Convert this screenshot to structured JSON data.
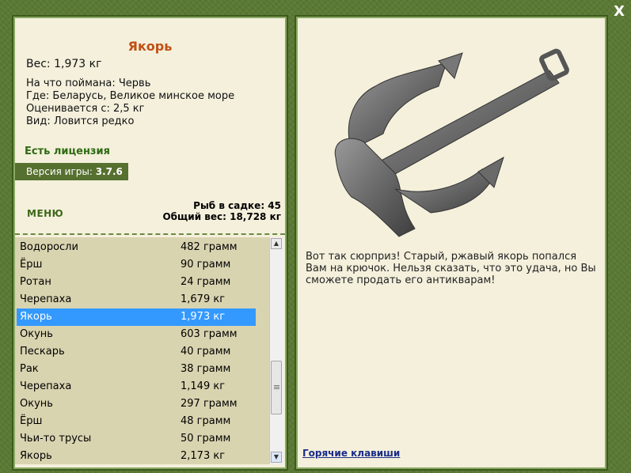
{
  "close_label": "X",
  "fish": {
    "title": "Якорь",
    "weight": "Вес: 1,973 кг",
    "caught_on": "На что поймана: Червь",
    "where": "Где: Беларусь, Великое минское море",
    "valued_from": "Оценивается с: 2,5 кг",
    "kind": "Вид: Ловится редко"
  },
  "license": "Есть лицензия",
  "version": {
    "label": "Версия игры:",
    "value": "3.7.6"
  },
  "menu_label": "МЕНЮ",
  "stats": {
    "fish_count": "Рыб в садке: 45",
    "total_weight": "Общий вес: 18,728 кг"
  },
  "catch_list": [
    {
      "name": "Водоросли",
      "weight": "482 грамм"
    },
    {
      "name": "Ёрш",
      "weight": "90 грамм"
    },
    {
      "name": "Ротан",
      "weight": "24 грамм"
    },
    {
      "name": "Черепаха",
      "weight": "1,679 кг"
    },
    {
      "name": "Якорь",
      "weight": "1,973 кг",
      "selected": true
    },
    {
      "name": "Окунь",
      "weight": "603 грамм"
    },
    {
      "name": "Пескарь",
      "weight": "40 грамм"
    },
    {
      "name": "Рак",
      "weight": "38 грамм"
    },
    {
      "name": "Черепаха",
      "weight": "1,149 кг"
    },
    {
      "name": "Окунь",
      "weight": "297 грамм"
    },
    {
      "name": "Ёрш",
      "weight": "48 грамм"
    },
    {
      "name": "Чьи-то трусы",
      "weight": "50 грамм"
    },
    {
      "name": "Якорь",
      "weight": "2,173 кг"
    }
  ],
  "description": "Вот так сюрприз! Старый, ржавый якорь попался Вам на крючок. Нельзя сказать, что это удача, но Вы сможете продать его антикварам!",
  "hotkeys_label": "Горячие клавиши",
  "icons": {
    "close": "close-icon",
    "scroll_up": "scroll-up-arrow-icon",
    "scroll_down": "scroll-down-arrow-icon",
    "anchor": "anchor-image"
  },
  "colors": {
    "background": "#5b7a34",
    "panel": "#f4f0dc",
    "title": "#c05014",
    "license": "#2f6a12",
    "selection": "#3399ff"
  }
}
